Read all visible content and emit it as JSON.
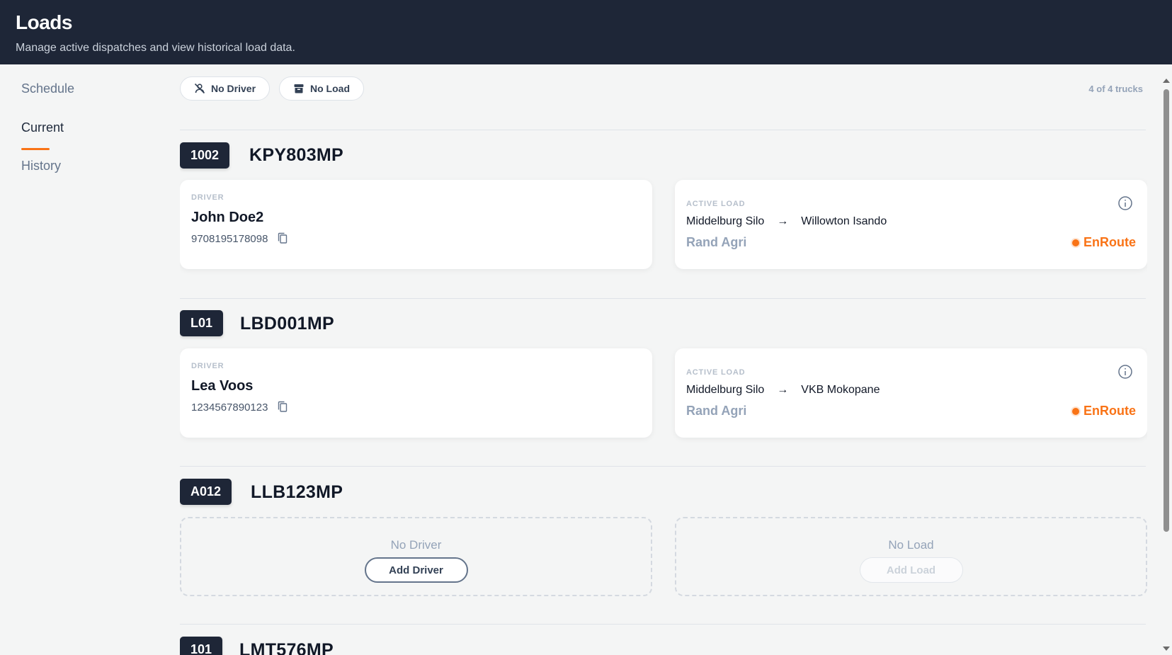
{
  "header": {
    "title": "Loads",
    "subtitle": "Manage active dispatches and view historical load data."
  },
  "sidebar": {
    "items": [
      {
        "label": "Schedule",
        "active": false
      },
      {
        "label": "Current",
        "active": true
      },
      {
        "label": "History",
        "active": false
      }
    ]
  },
  "filters": {
    "no_driver_label": "No Driver",
    "no_load_label": "No Load",
    "count_text": "4 of 4 trucks"
  },
  "labels": {
    "driver": "DRIVER",
    "active_load": "ACTIVE LOAD",
    "route_arrow": "→"
  },
  "trucks": [
    {
      "id": "1002",
      "plate": "KPY803MP",
      "driver": {
        "name": "John Doe2",
        "id_number": "9708195178098"
      },
      "load": {
        "from": "Middelburg Silo",
        "to": "Willowton Isando",
        "client": "Rand Agri",
        "status": "EnRoute"
      }
    },
    {
      "id": "L01",
      "plate": "LBD001MP",
      "driver": {
        "name": "Lea Voos",
        "id_number": "1234567890123"
      },
      "load": {
        "from": "Middelburg Silo",
        "to": "VKB Mokopane",
        "client": "Rand Agri",
        "status": "EnRoute"
      }
    },
    {
      "id": "A012",
      "plate": "LLB123MP",
      "empty_driver": {
        "title": "No Driver",
        "button": "Add Driver"
      },
      "empty_load": {
        "title": "No Load",
        "button": "Add Load"
      }
    },
    {
      "id": "101",
      "plate": "LMT576MP"
    }
  ],
  "colors": {
    "header_bg": "#1e2637",
    "accent": "#f97316",
    "status_enroute": "#f97316"
  },
  "icons": [
    "no-driver-icon",
    "no-load-icon",
    "copy-icon",
    "info-icon"
  ]
}
